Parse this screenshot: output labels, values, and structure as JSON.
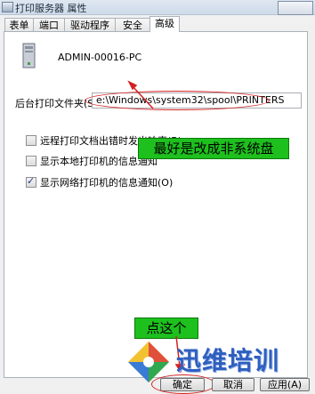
{
  "window": {
    "title": "打印服务器 属性"
  },
  "tabs": [
    {
      "label": "表单"
    },
    {
      "label": "端口"
    },
    {
      "label": "驱动程序"
    },
    {
      "label": "安全"
    },
    {
      "label": "高级",
      "active": true
    }
  ],
  "server": {
    "name": "ADMIN-00016-PC"
  },
  "spool": {
    "label": "后台打印文件夹(S):",
    "path": "e:\\Windows\\system32\\spool\\PRINTERS"
  },
  "options": [
    {
      "label": "远程打印文档出错时发出响声(B)",
      "checked": false
    },
    {
      "label": "显示本地打印机的信息通知",
      "checked": false
    },
    {
      "label": "显示网络打印机的信息通知(O)",
      "checked": true
    }
  ],
  "annotations": {
    "tip": "最好是改成非系统盘",
    "click_here": "点这个"
  },
  "brand": {
    "text": "迅维培训"
  },
  "buttons": {
    "ok": "确定",
    "cancel": "取消",
    "apply": "应用(A)"
  },
  "colors": {
    "callout": "#1ec01e",
    "highlight": "#d42020",
    "brand": "#2f5fbf"
  }
}
